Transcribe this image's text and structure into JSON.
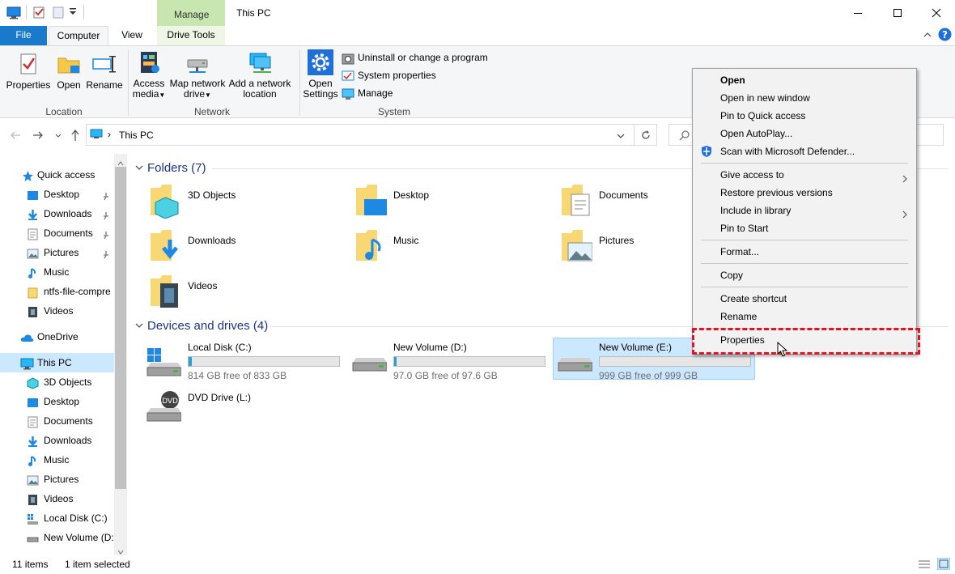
{
  "window": {
    "title": "This PC",
    "manage_tab": "Manage"
  },
  "ribbon_tabs": [
    "File",
    "Computer",
    "View",
    "Drive Tools"
  ],
  "ribbon": {
    "location": {
      "label": "Location",
      "properties": "Properties",
      "open": "Open",
      "rename": "Rename"
    },
    "network": {
      "label": "Network",
      "access_media_1": "Access",
      "access_media_2": "media",
      "map_drive_1": "Map network",
      "map_drive_2": "drive",
      "add_location_1": "Add a network",
      "add_location_2": "location"
    },
    "system": {
      "label": "System",
      "open_settings_1": "Open",
      "open_settings_2": "Settings",
      "uninstall": "Uninstall or change a program",
      "system_properties": "System properties",
      "manage": "Manage"
    }
  },
  "address": {
    "path": "This PC"
  },
  "nav": {
    "quick_access": "Quick access",
    "quick_items": [
      "Desktop",
      "Downloads",
      "Documents",
      "Pictures",
      "Music",
      "ntfs-file-compre",
      "Videos"
    ],
    "onedrive": "OneDrive",
    "this_pc": "This PC",
    "pc_items": [
      "3D Objects",
      "Desktop",
      "Documents",
      "Downloads",
      "Music",
      "Pictures",
      "Videos",
      "Local Disk (C:)",
      "New Volume (D:"
    ]
  },
  "content": {
    "folders_header": "Folders (7)",
    "folders": [
      "3D Objects",
      "Desktop",
      "Documents",
      "Downloads",
      "Music",
      "Pictures",
      "Videos"
    ],
    "devices_header": "Devices and drives (4)",
    "drives": [
      {
        "name": "Local Disk (C:)",
        "free": "814 GB free of 833 GB",
        "used_fraction": 0.023
      },
      {
        "name": "New Volume (D:)",
        "free": "97.0 GB free of 97.6 GB",
        "used_fraction": 0.006
      },
      {
        "name": "New Volume (E:)",
        "free": "999 GB free of 999 GB",
        "used_fraction": 0.0
      },
      {
        "name": "DVD Drive (L:)",
        "free": ""
      }
    ]
  },
  "context_menu": {
    "items": [
      "Open",
      "Open in new window",
      "Pin to Quick access",
      "Open AutoPlay...",
      "Scan with Microsoft Defender...",
      "Give access to",
      "Restore previous versions",
      "Include in library",
      "Pin to Start",
      "Format...",
      "Copy",
      "Create shortcut",
      "Rename",
      "Properties"
    ]
  },
  "status": {
    "items": "11 items",
    "selected": "1 item selected"
  },
  "colors": {
    "accent": "#1979ca",
    "highlight_dash": "#e81123",
    "selected_bg": "#cce8ff",
    "usage_bar": "#26a0da"
  }
}
